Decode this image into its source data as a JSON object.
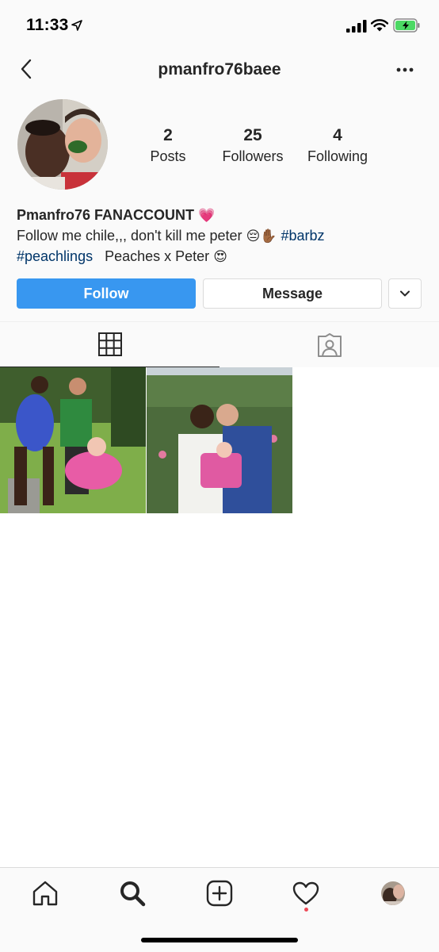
{
  "status_bar": {
    "time": "11:33"
  },
  "header": {
    "username": "pmanfro76baee"
  },
  "profile": {
    "stats": [
      {
        "value": "2",
        "label": "Posts"
      },
      {
        "value": "25",
        "label": "Followers"
      },
      {
        "value": "4",
        "label": "Following"
      }
    ],
    "bio": {
      "name": "Pmanfro76 FANACCOUNT",
      "name_emoji": "💗",
      "line1_text": "Follow me chile,,, don't kill me peter",
      "line1_emojis": "😔✋🏾",
      "hashtag1": "#barbz",
      "hashtag2": "#peachlings",
      "line2_text": "Peaches x Peter",
      "line2_emoji": "😍"
    }
  },
  "actions": {
    "follow_label": "Follow",
    "message_label": "Message"
  },
  "tabs": [
    {
      "icon": "grid-icon",
      "active": true
    },
    {
      "icon": "tagged-icon",
      "active": false
    }
  ],
  "posts": [
    {
      "description": "photo-collage-outdoor"
    },
    {
      "description": "photo-collage-field"
    }
  ],
  "tab_bar": {
    "items": [
      "home-icon",
      "search-icon",
      "add-post-icon",
      "activity-icon",
      "profile-avatar"
    ],
    "activity_notification": true
  },
  "colors": {
    "accent": "#3897f0",
    "hashtag": "#003569",
    "notification": "#ed4956",
    "battery": "#4cd964"
  }
}
